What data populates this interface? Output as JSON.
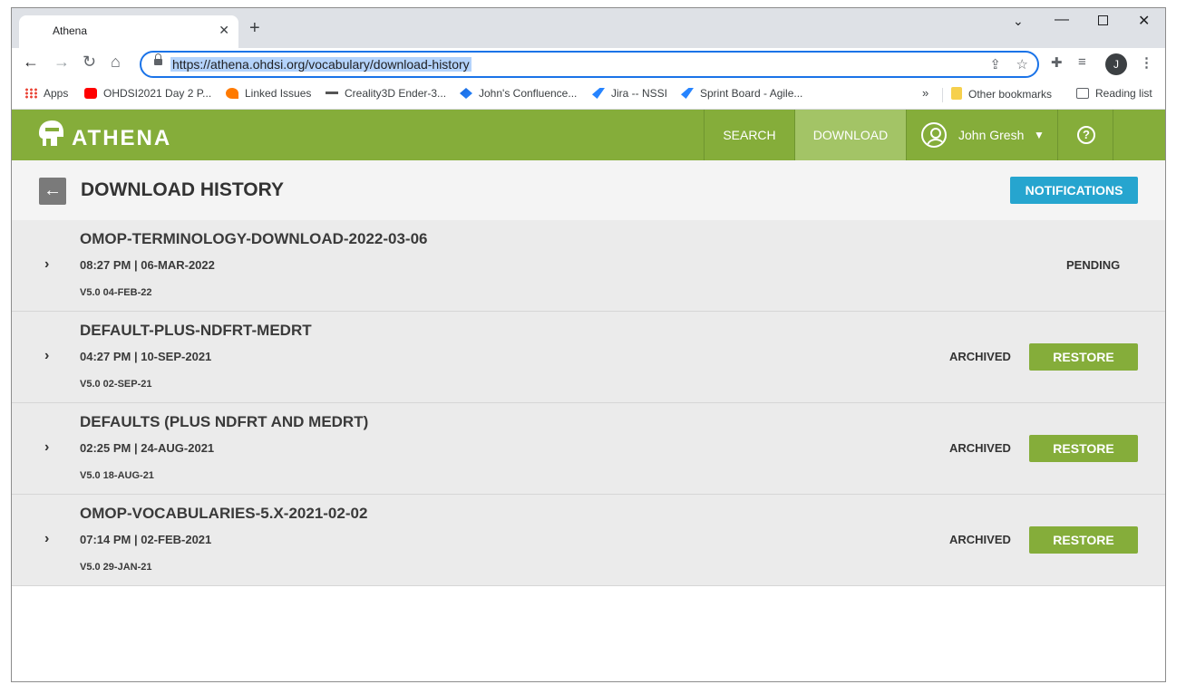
{
  "browser": {
    "tab_title": "Athena",
    "url": "https://athena.ohdsi.org/vocabulary/download-history",
    "bookmarks": [
      {
        "label": "Apps",
        "icon": "apps-grid-icon"
      },
      {
        "label": "OHDSI2021 Day 2 P...",
        "icon": "youtube-icon"
      },
      {
        "label": "Linked Issues",
        "icon": "linked-issues-icon"
      },
      {
        "label": "Creality3D Ender-3...",
        "icon": "creality-icon"
      },
      {
        "label": "John's Confluence...",
        "icon": "confluence-icon"
      },
      {
        "label": "Jira -- NSSI",
        "icon": "jira-icon"
      },
      {
        "label": "Sprint Board - Agile...",
        "icon": "jira-icon"
      }
    ],
    "more_bookmarks": "»",
    "other_bookmarks": "Other bookmarks",
    "reading_list": "Reading list",
    "profile_initial": "J"
  },
  "app": {
    "logo": "ATHENA",
    "nav": {
      "search": "SEARCH",
      "download": "DOWNLOAD",
      "user": "John Gresh",
      "help": "?"
    },
    "page_title": "DOWNLOAD HISTORY",
    "notifications_label": "NOTIFICATIONS",
    "restore_label": "RESTORE",
    "downloads": [
      {
        "name": "OMOP-TERMINOLOGY-DOWNLOAD-2022-03-06",
        "date": "08:27 PM | 06-MAR-2022",
        "version": "V5.0 04-FEB-22",
        "status": "PENDING"
      },
      {
        "name": "DEFAULT-PLUS-NDFRT-MEDRT",
        "date": "04:27 PM | 10-SEP-2021",
        "version": "V5.0 02-SEP-21",
        "status": "ARCHIVED"
      },
      {
        "name": "DEFAULTS (PLUS NDFRT AND MEDRT)",
        "date": "02:25 PM | 24-AUG-2021",
        "version": "V5.0 18-AUG-21",
        "status": "ARCHIVED"
      },
      {
        "name": "OMOP-VOCABULARIES-5.X-2021-02-02",
        "date": "07:14 PM | 02-FEB-2021",
        "version": "V5.0 29-JAN-21",
        "status": "ARCHIVED"
      }
    ]
  },
  "colors": {
    "header_green": "#85ad3a",
    "active_nav": "#a3c466",
    "notifications_blue": "#26a5cf",
    "row_bg": "#ebebeb"
  }
}
